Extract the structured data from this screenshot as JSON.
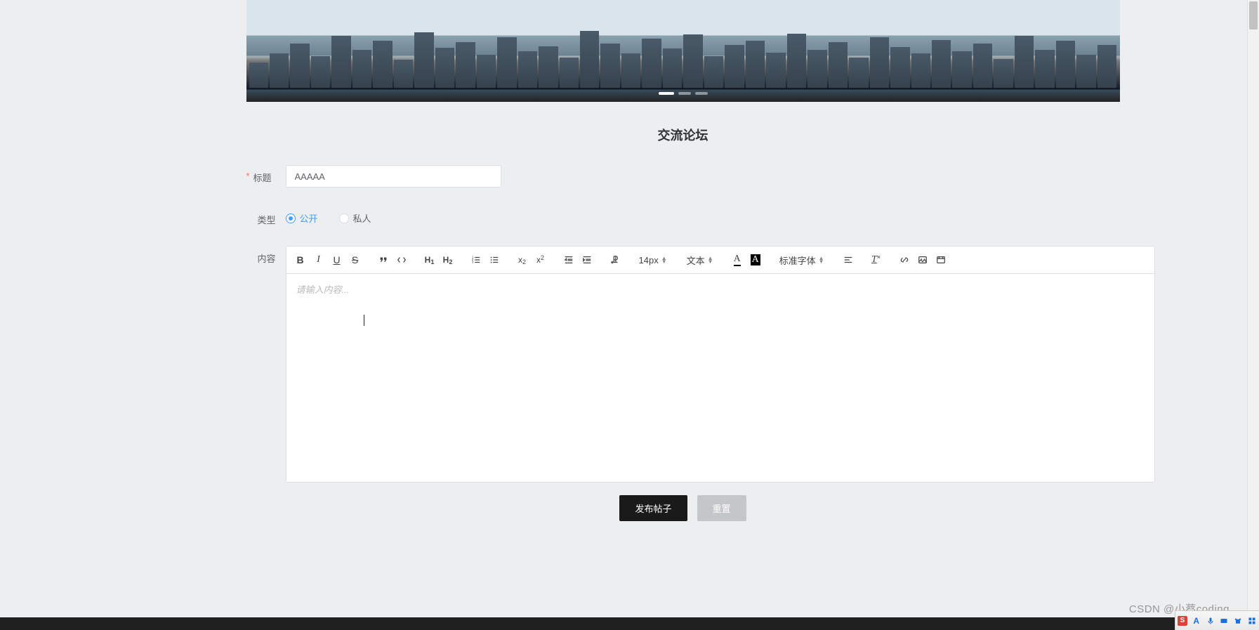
{
  "page": {
    "title": "交流论坛"
  },
  "carousel": {
    "slide_count": 3,
    "active_index": 0
  },
  "form": {
    "title_label": "标题",
    "title_value": "AAAAA",
    "type_label": "类型",
    "type_options": {
      "public": "公开",
      "private": "私人"
    },
    "type_selected": "public",
    "content_label": "内容"
  },
  "editor": {
    "placeholder": "请输入内容...",
    "font_size": "14px",
    "text_style": "文本",
    "font_family": "标准字体",
    "toolbar": {
      "bold": "B",
      "italic": "I",
      "underline": "U",
      "strike": "S",
      "h1": "H₁",
      "h2": "H₂",
      "sub_label": "x",
      "sup_label": "x",
      "text_color": "A",
      "bg_color": "A"
    }
  },
  "buttons": {
    "submit": "发布帖子",
    "reset": "重置"
  },
  "watermark": "CSDN @小蔡coding",
  "ime": {
    "logo": "S",
    "lang": "A"
  }
}
